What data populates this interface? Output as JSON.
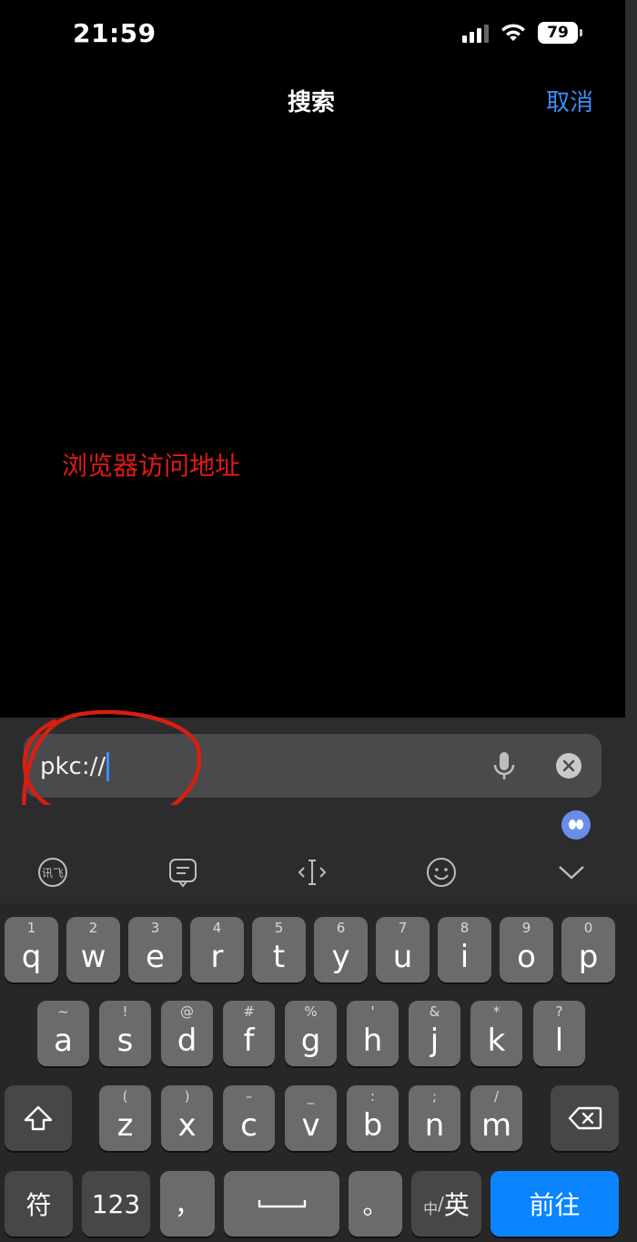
{
  "status": {
    "time": "21:59",
    "battery": "79"
  },
  "nav": {
    "title": "搜索",
    "cancel": "取消"
  },
  "annotation": "浏览器访问地址",
  "search": {
    "value": "pkc://"
  },
  "keyboard": {
    "row1": [
      {
        "hint": "1",
        "key": "q"
      },
      {
        "hint": "2",
        "key": "w"
      },
      {
        "hint": "3",
        "key": "e"
      },
      {
        "hint": "4",
        "key": "r"
      },
      {
        "hint": "5",
        "key": "t"
      },
      {
        "hint": "6",
        "key": "y"
      },
      {
        "hint": "7",
        "key": "u"
      },
      {
        "hint": "8",
        "key": "i"
      },
      {
        "hint": "9",
        "key": "o"
      },
      {
        "hint": "0",
        "key": "p"
      }
    ],
    "row2": [
      {
        "hint": "~",
        "key": "a"
      },
      {
        "hint": "!",
        "key": "s"
      },
      {
        "hint": "@",
        "key": "d"
      },
      {
        "hint": "#",
        "key": "f"
      },
      {
        "hint": "%",
        "key": "g"
      },
      {
        "hint": "'",
        "key": "h"
      },
      {
        "hint": "&",
        "key": "j"
      },
      {
        "hint": "*",
        "key": "k"
      },
      {
        "hint": "?",
        "key": "l"
      }
    ],
    "row3": [
      {
        "hint": "(",
        "key": "z"
      },
      {
        "hint": ")",
        "key": "x"
      },
      {
        "hint": "–",
        "key": "c"
      },
      {
        "hint": "_",
        "key": "v"
      },
      {
        "hint": ":",
        "key": "b"
      },
      {
        "hint": ";",
        "key": "n"
      },
      {
        "hint": "/",
        "key": "m"
      }
    ],
    "symbols": "符",
    "numbers": "123",
    "comma": "，",
    "period": "。",
    "lang_small": "中",
    "lang_sep": "/",
    "lang_big": "英",
    "go": "前往"
  }
}
